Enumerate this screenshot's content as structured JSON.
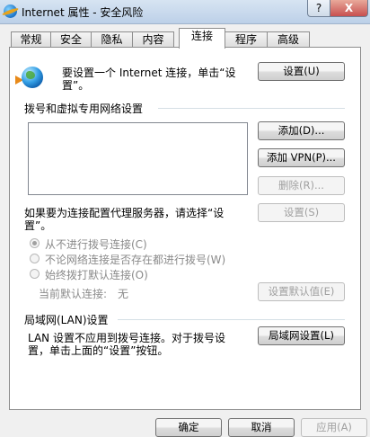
{
  "window": {
    "title": "Internet 属性 - 安全风险",
    "help_label": "?",
    "close_label": "X"
  },
  "tabs": [
    {
      "label": "常规"
    },
    {
      "label": "安全"
    },
    {
      "label": "隐私"
    },
    {
      "label": "内容"
    },
    {
      "label": "连接"
    },
    {
      "label": "程序"
    },
    {
      "label": "高级"
    }
  ],
  "active_tab": "连接",
  "setup": {
    "text_line1": "要设置一个 Internet 连接，单击“设",
    "text_line2": "置”。",
    "button_label": "设置(U)"
  },
  "dialup": {
    "section_title": "拨号和虚拟专用网络设置",
    "add_label": "添加(D)...",
    "add_vpn_label": "添加 VPN(P)...",
    "delete_label": "删除(R)...",
    "proxy_text_line1": "如果要为连接配置代理服务器，请选择“设",
    "proxy_text_line2": "置”。",
    "settings_label": "设置(S)",
    "options": [
      {
        "label": "从不进行拨号连接(C)",
        "checked": true
      },
      {
        "label": "不论网络连接是否存在都进行拨号(W)",
        "checked": false
      },
      {
        "label": "始终拨打默认连接(O)",
        "checked": false
      }
    ],
    "current_default_label": "当前默认连接:",
    "current_default_value": "无",
    "set_default_label": "设置默认值(E)"
  },
  "lan": {
    "section_title": "局域网(LAN)设置",
    "text_line1": "LAN 设置不应用到拨号连接。对于拨号设",
    "text_line2": "置，单击上面的“设置”按钮。",
    "button_label": "局域网设置(L)"
  },
  "footer": {
    "ok_label": "确定",
    "cancel_label": "取消",
    "apply_label": "应用(A)"
  }
}
